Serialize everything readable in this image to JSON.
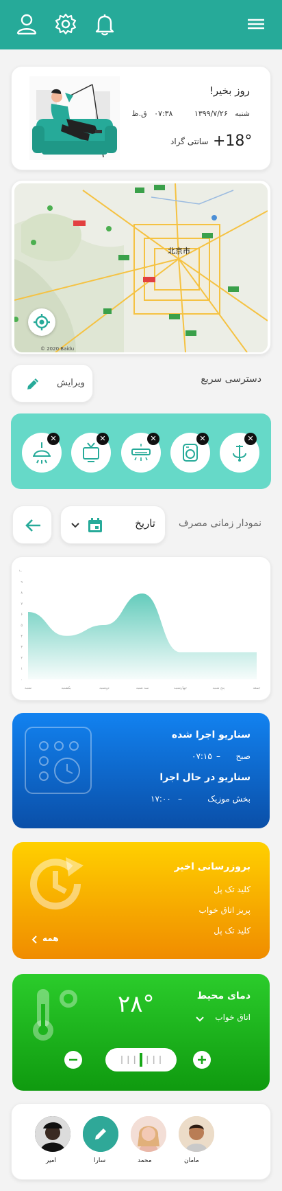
{
  "greeting": {
    "title": "روز بخیر!",
    "day": "شنبه",
    "date": "۱۳۹۹/۷/۲۶",
    "time": "۰۷:۳۸",
    "time_suffix": "ق.ظ",
    "temperature": "+18°",
    "temperature_unit": "سانتی گراد"
  },
  "map": {
    "city_label": "北京市",
    "copyright": "© 2020 Baidu"
  },
  "quick_access": {
    "title": "دسترسی سریع",
    "edit_label": "ویرایش",
    "devices": [
      {
        "icon": "lamp-icon"
      },
      {
        "icon": "tv-icon"
      },
      {
        "icon": "air-conditioner-icon"
      },
      {
        "icon": "washing-machine-icon"
      },
      {
        "icon": "faucet-icon"
      }
    ]
  },
  "usage": {
    "title": "نمودار زمانی مصرف",
    "date_select": "تاریخ"
  },
  "chart_data": {
    "type": "area",
    "categories": [
      "شنبه",
      "یکشنبه",
      "دوشنبه",
      "سه شنبه",
      "چهارشنبه",
      "پنج شنبه",
      "جمعه"
    ],
    "values": [
      6.2,
      4.0,
      5.0,
      7.9,
      2.5,
      2.5,
      2.5
    ],
    "ylim": [
      0,
      10
    ],
    "yticks": [
      "۰",
      "۱",
      "۲",
      "۳",
      "۴",
      "۵",
      "۶",
      "۷",
      "۸",
      "۹",
      "۱۰"
    ],
    "grid": false,
    "color": "#5cc9b8"
  },
  "scenario": {
    "executed_title": "سناریو اجرا شده",
    "executed_name": "صبح",
    "executed_time": "۰۷:۱۵",
    "running_title": "سناریو در حال اجرا",
    "running_name": "بخش موزیک",
    "running_time": "۱۷:۰۰",
    "dash": "–"
  },
  "updates": {
    "title": "بروزرسانی اخیر",
    "items": [
      "کلید تک پل",
      "پریز اتاق خواب",
      "کلید تک پل"
    ],
    "all_label": "همه"
  },
  "climate": {
    "title": "دمای محیط",
    "room": "اتاق خواب",
    "value": "۲۸°",
    "level": 0.5
  },
  "users": [
    {
      "name": "مامان"
    },
    {
      "name": "محمد"
    },
    {
      "name": "سارا"
    },
    {
      "name": "امیر"
    }
  ],
  "colors": {
    "primary": "#26aa99",
    "quick_bg": "#66d9c8",
    "scenario_top": "#1282f0",
    "scenario_bottom": "#0a4fa8",
    "update_top": "#ffd000",
    "update_bottom": "#f08c00",
    "climate_top": "#2bcc2b",
    "climate_bottom": "#0f9a0f"
  }
}
